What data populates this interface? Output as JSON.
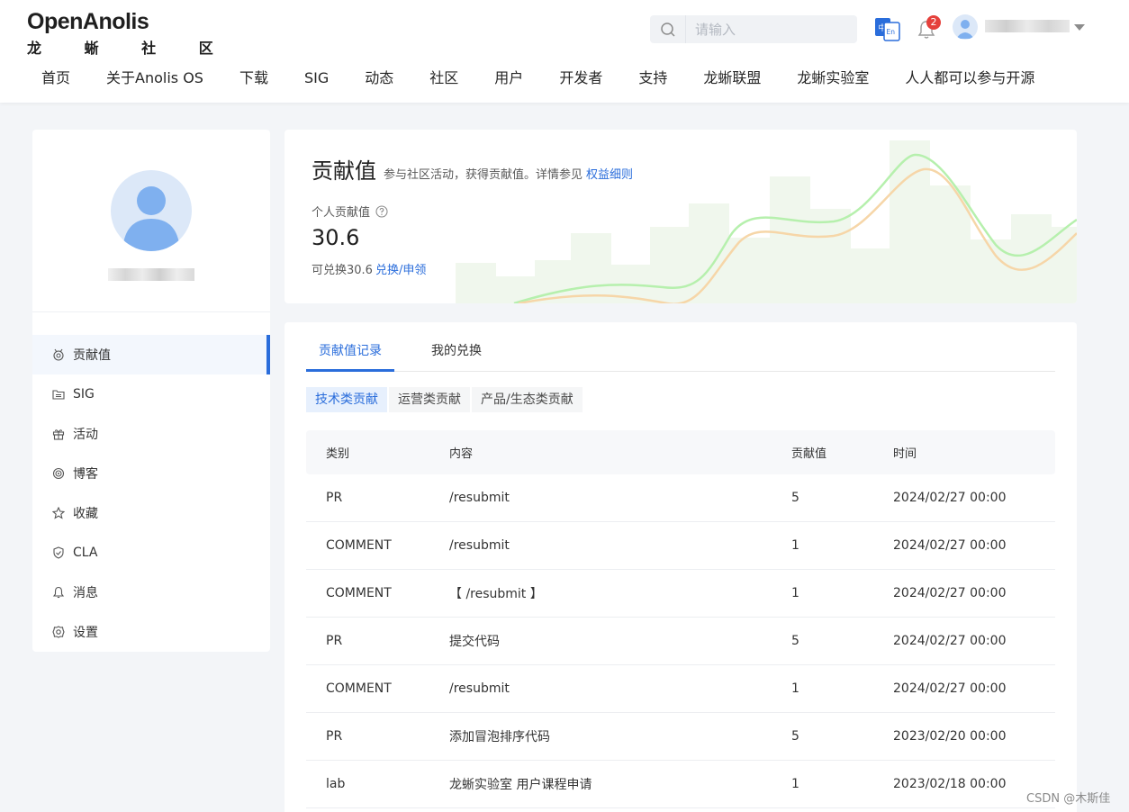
{
  "logo": {
    "wordmark": "OpenAnolis",
    "subtitle": "龙 蜥 社 区"
  },
  "search": {
    "placeholder": "请输入"
  },
  "notifications": {
    "count": "2"
  },
  "nav": [
    "首页",
    "关于Anolis OS",
    "下载",
    "SIG",
    "动态",
    "社区",
    "用户",
    "开发者",
    "支持",
    "龙蜥联盟",
    "龙蜥实验室",
    "人人都可以参与开源"
  ],
  "sidebar": {
    "items": [
      {
        "label": "贡献值",
        "icon": "medal-icon"
      },
      {
        "label": "SIG",
        "icon": "folder-icon"
      },
      {
        "label": "活动",
        "icon": "gift-icon"
      },
      {
        "label": "博客",
        "icon": "target-icon"
      },
      {
        "label": "收藏",
        "icon": "star-icon"
      },
      {
        "label": "CLA",
        "icon": "shield-icon"
      },
      {
        "label": "消息",
        "icon": "bell-icon"
      },
      {
        "label": "设置",
        "icon": "gear-icon"
      }
    ]
  },
  "score": {
    "title": "贡献值",
    "description": "参与社区活动，获得贡献值。详情参见",
    "link": "权益细则",
    "label": "个人贡献值",
    "value": "30.6",
    "exchange_text": "可兑换30.6",
    "exchange_link": "兑换/申领"
  },
  "tabs": [
    "贡献值记录",
    "我的兑换"
  ],
  "subtabs": [
    "技术类贡献",
    "运营类贡献",
    "产品/生态类贡献"
  ],
  "table": {
    "headers": [
      "类别",
      "内容",
      "贡献值",
      "时间"
    ],
    "rows": [
      [
        "PR",
        "/resubmit",
        "5",
        "2024/02/27 00:00"
      ],
      [
        "COMMENT",
        "/resubmit",
        "1",
        "2024/02/27 00:00"
      ],
      [
        "COMMENT",
        "【 /resubmit 】",
        "1",
        "2024/02/27 00:00"
      ],
      [
        "PR",
        "提交代码",
        "5",
        "2024/02/27 00:00"
      ],
      [
        "COMMENT",
        "/resubmit",
        "1",
        "2024/02/27 00:00"
      ],
      [
        "PR",
        "添加冒泡排序代码",
        "5",
        "2023/02/20 00:00"
      ],
      [
        "lab",
        "龙蜥实验室 用户课程申请",
        "1",
        "2023/02/18 00:00"
      ]
    ]
  },
  "watermark": "CSDN @木斯佳",
  "colors": {
    "accent": "#2a6ddb",
    "badge": "#e5403b",
    "green_curve": "#a8f0a0",
    "orange_curve": "#f6cf98"
  }
}
